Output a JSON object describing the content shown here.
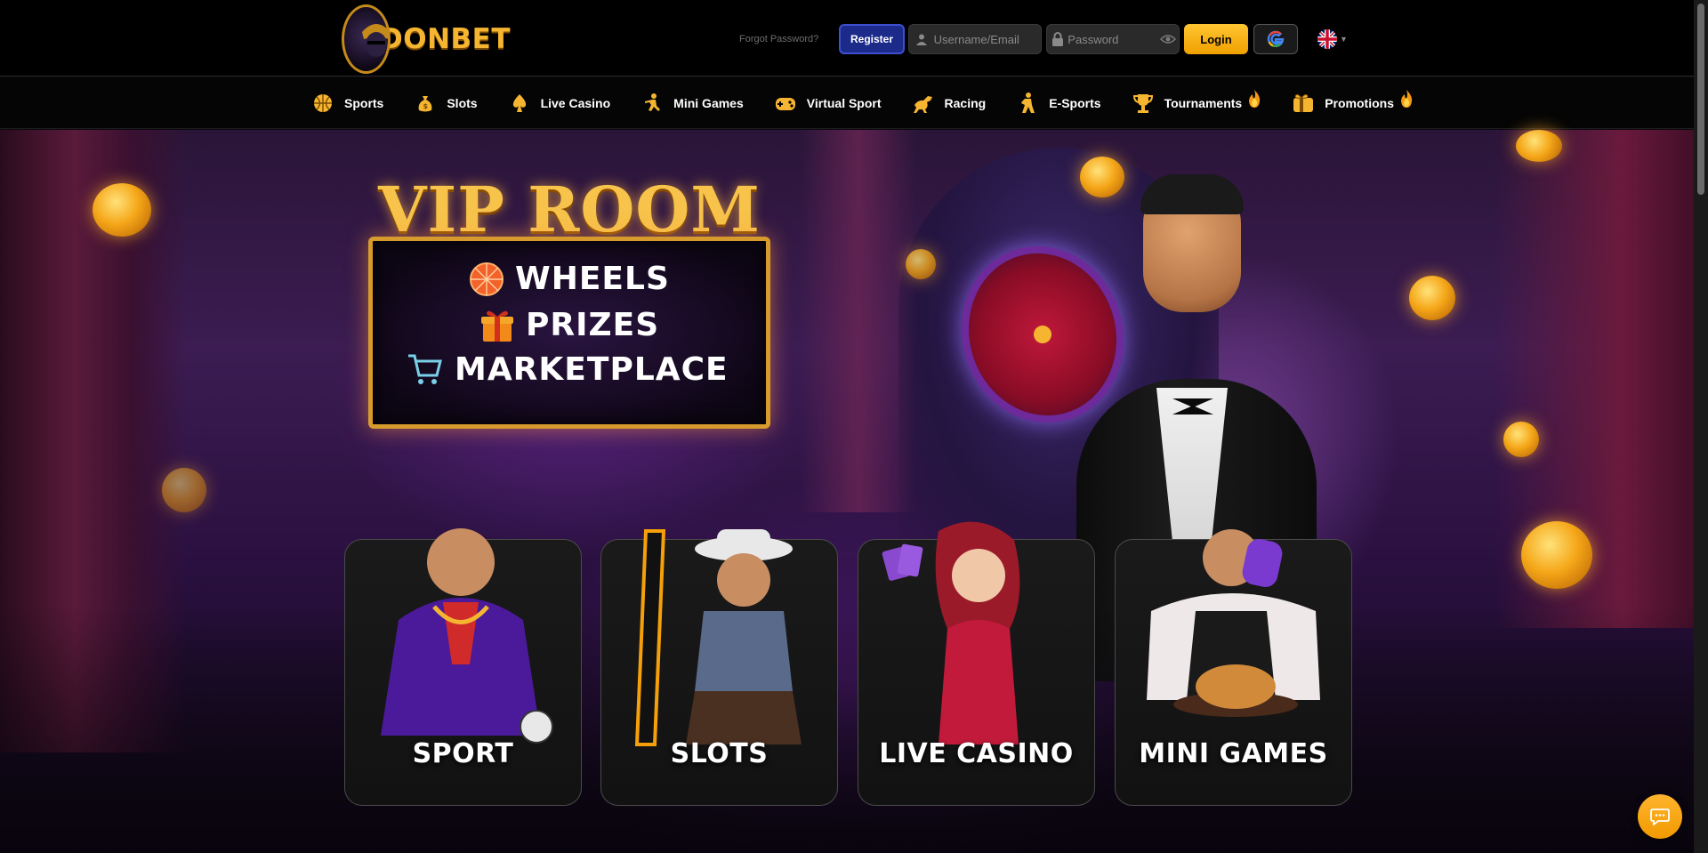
{
  "brand": {
    "name": "DONBET"
  },
  "header": {
    "forgot_password": "Forgot Password?",
    "register_label": "Register",
    "username_placeholder": "Username/Email",
    "password_placeholder": "Password",
    "login_label": "Login",
    "language": "en-GB"
  },
  "nav": {
    "items": [
      {
        "label": "Sports",
        "icon": "basketball-icon"
      },
      {
        "label": "Slots",
        "icon": "money-bag-icon"
      },
      {
        "label": "Live Casino",
        "icon": "spade-icon"
      },
      {
        "label": "Mini Games",
        "icon": "mini-games-icon"
      },
      {
        "label": "Virtual Sport",
        "icon": "gamepad-icon"
      },
      {
        "label": "Racing",
        "icon": "horse-icon"
      },
      {
        "label": "E-Sports",
        "icon": "esports-player-icon"
      },
      {
        "label": "Tournaments",
        "icon": "trophy-icon",
        "hot": true
      },
      {
        "label": "Promotions",
        "icon": "gift-icon",
        "hot": true
      }
    ]
  },
  "banner": {
    "title": "VIP ROOM",
    "lines": [
      {
        "label": "WHEELS",
        "icon": "wheel-icon"
      },
      {
        "label": "PRIZES",
        "icon": "gift-box-icon"
      },
      {
        "label": "MARKETPLACE",
        "icon": "cart-icon"
      }
    ]
  },
  "categories": [
    {
      "label": "SPORT"
    },
    {
      "label": "SLOTS"
    },
    {
      "label": "LIVE CASINO"
    },
    {
      "label": "MINI GAMES"
    }
  ],
  "colors": {
    "accent": "#f5b531",
    "register": "#1c2a8a",
    "login": "#f0a000"
  }
}
